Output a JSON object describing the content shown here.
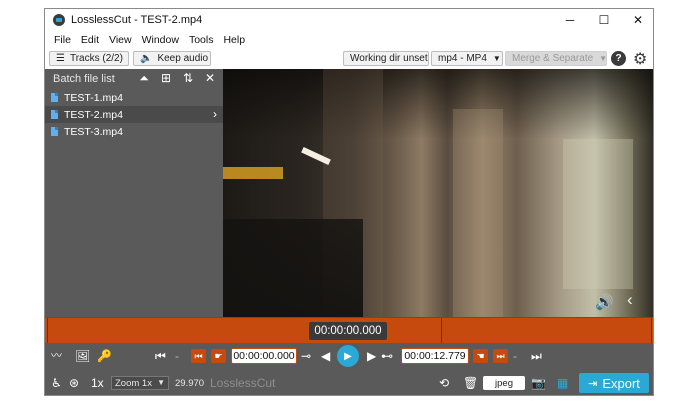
{
  "window": {
    "title": "LosslessCut - TEST-2.mp4",
    "controls": {
      "minimize": "─",
      "maximize": "☐",
      "close": "✕"
    }
  },
  "menu": [
    "File",
    "Edit",
    "View",
    "Window",
    "Tools",
    "Help"
  ],
  "toolbar": {
    "tracks_label": "Tracks (2/2)",
    "audio_label": "Keep audio",
    "working_dir": "Working dir unset",
    "format": "mp4 - MP4",
    "merge": "Merge & Separate",
    "help_icon": "?"
  },
  "sidebar": {
    "title": "Batch file list",
    "files": [
      {
        "name": "TEST-1.mp4",
        "active": false
      },
      {
        "name": "TEST-2.mp4",
        "active": true
      },
      {
        "name": "TEST-3.mp4",
        "active": false
      }
    ]
  },
  "timeline": {
    "current_time": "00:00:00.000"
  },
  "controls": {
    "cut_start": "00:00:00.000",
    "cut_end": "00:00:12.779"
  },
  "bottombar": {
    "speed": "1x",
    "zoom": "Zoom 1x",
    "fps": "29.970",
    "app_name": "LosslessCut",
    "capture_format": "jpeg",
    "export_label": "Export"
  },
  "icons": {
    "tracks": "list-icon",
    "audio": "speaker-icon",
    "gear": "gear-icon",
    "volume": "volume-icon",
    "collapse": "chevron-left-icon"
  },
  "colors": {
    "accent_orange": "#c64a0e",
    "accent_blue": "#2aa8d6",
    "panel_gray": "#5a5a5a"
  }
}
